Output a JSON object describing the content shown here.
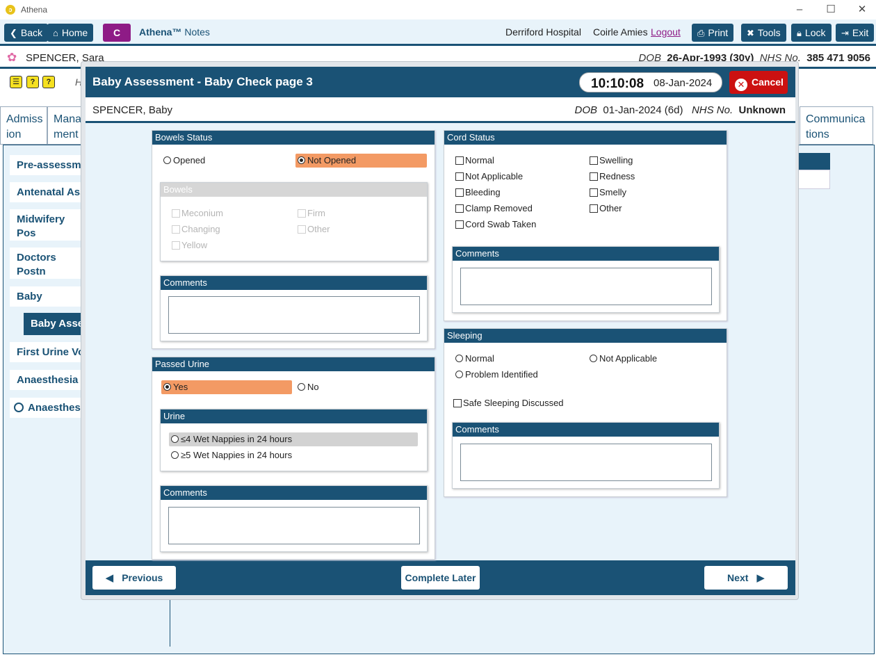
{
  "window": {
    "title": "Athena"
  },
  "toolbar": {
    "back": "Back",
    "home": "Home",
    "c_badge": "C",
    "app_name": "Athena™",
    "app_module": "Notes",
    "hospital": "Derriford Hospital",
    "user": "Coirle Amies",
    "logout": "Logout",
    "print": "Print",
    "tools": "Tools",
    "lock": "Lock",
    "exit": "Exit"
  },
  "patient": {
    "name": "SPENCER, Sara",
    "dob_label": "DOB",
    "dob": "26-Apr-1993 (30y)",
    "nhs_label": "NHS No.",
    "nhs": "385 471 9056"
  },
  "background": {
    "h_fragment": "H",
    "tabs": [
      "Admiss ion",
      "Mana ment",
      "Communica tions"
    ],
    "nav_items": [
      "Pre-assessmen",
      "Antenatal Ass",
      "Midwifery Pos Assessments",
      "Doctors Postn Assessments",
      "Baby",
      "Baby Assess",
      "First Urine Voi",
      "Anaesthesia In",
      "Anaesthesia"
    ]
  },
  "dialog": {
    "title": "Baby Assessment - Baby Check page 3",
    "time": "10:10:08",
    "date": "08-Jan-2024",
    "cancel": "Cancel",
    "baby": {
      "name": "SPENCER, Baby",
      "dob_label": "DOB",
      "dob": "01-Jan-2024 (6d)",
      "nhs_label": "NHS No.",
      "nhs": "Unknown"
    },
    "footer": {
      "previous": "Previous",
      "complete_later": "Complete Later",
      "next": "Next"
    }
  },
  "bowels_status": {
    "header": "Bowels Status",
    "opened": "Opened",
    "not_opened": "Not Opened",
    "selected": "Not Opened",
    "bowels": {
      "header": "Bowels",
      "meconium": "Meconium",
      "firm": "Firm",
      "changing": "Changing",
      "other": "Other",
      "yellow": "Yellow"
    },
    "comments_header": "Comments"
  },
  "passed_urine": {
    "header": "Passed Urine",
    "yes": "Yes",
    "no": "No",
    "selected": "Yes",
    "urine": {
      "header": "Urine",
      "le4": "≤4 Wet Nappies in 24 hours",
      "ge5": "≥5 Wet Nappies in 24 hours"
    },
    "comments_header": "Comments"
  },
  "cord_status": {
    "header": "Cord Status",
    "normal": "Normal",
    "not_applicable": "Not Applicable",
    "bleeding": "Bleeding",
    "clamp_removed": "Clamp Removed",
    "cord_swab": "Cord Swab Taken",
    "swelling": "Swelling",
    "redness": "Redness",
    "smelly": "Smelly",
    "other": "Other",
    "comments_header": "Comments"
  },
  "sleeping": {
    "header": "Sleeping",
    "normal": "Normal",
    "not_applicable": "Not Applicable",
    "problem": "Problem Identified",
    "safe_sleeping": "Safe Sleeping Discussed",
    "comments_header": "Comments"
  },
  "colors": {
    "primary": "#1a5275",
    "highlight": "#f39a64",
    "cancel": "#cc1111",
    "c_badge": "#8e1b86"
  }
}
